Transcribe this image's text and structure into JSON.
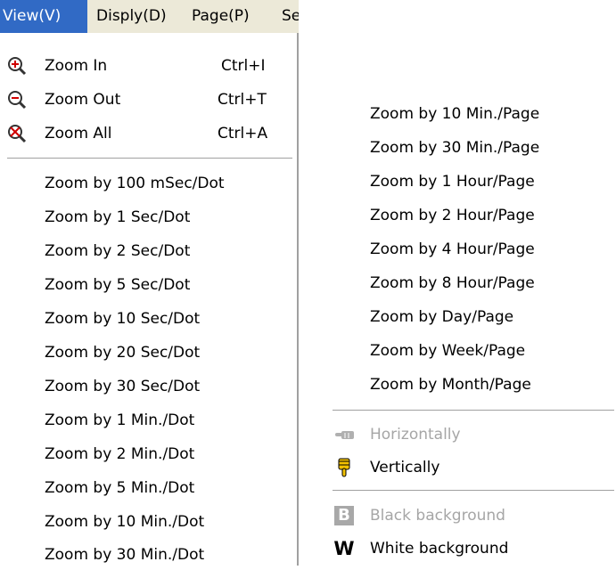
{
  "menubar": {
    "items": [
      {
        "label": "View(V)"
      },
      {
        "label": "Disply(D)"
      },
      {
        "label": "Page(P)"
      },
      {
        "label": "Se"
      }
    ]
  },
  "menu_left": {
    "zoom_items": [
      {
        "label": "Zoom In",
        "shortcut": "Ctrl+I",
        "icon": "zoom-in-icon"
      },
      {
        "label": "Zoom Out",
        "shortcut": "Ctrl+T",
        "icon": "zoom-out-icon"
      },
      {
        "label": "Zoom All",
        "shortcut": "Ctrl+A",
        "icon": "zoom-all-icon"
      }
    ],
    "scale_items": [
      "Zoom by 100 mSec/Dot",
      "Zoom by 1 Sec/Dot",
      "Zoom by 2 Sec/Dot",
      "Zoom by 5 Sec/Dot",
      "Zoom by 10 Sec/Dot",
      "Zoom by 20 Sec/Dot",
      "Zoom by 30 Sec/Dot",
      "Zoom by 1 Min./Dot",
      "Zoom by 2 Min./Dot",
      "Zoom by 5 Min./Dot",
      "Zoom by 10 Min./Dot",
      "Zoom by 30 Min./Dot"
    ]
  },
  "menu_right": {
    "page_items": [
      "Zoom by 10 Min./Page",
      "Zoom by 30 Min./Page",
      "Zoom by 1 Hour/Page",
      "Zoom by 2 Hour/Page",
      "Zoom by 4 Hour/Page",
      "Zoom by 8 Hour/Page",
      "Zoom by Day/Page",
      "Zoom by Week/Page",
      "Zoom by Month/Page"
    ],
    "orientation": {
      "horizontally": "Horizontally",
      "vertically": "Vertically"
    },
    "background": {
      "black_letter": "B",
      "black": "Black background",
      "white_letter": "W",
      "white": "White background"
    }
  },
  "colors": {
    "menubar_bg": "#ece9d8",
    "highlight": "#316ac5",
    "disabled_text": "#a6a6a6",
    "separator": "#a0a0a0"
  }
}
